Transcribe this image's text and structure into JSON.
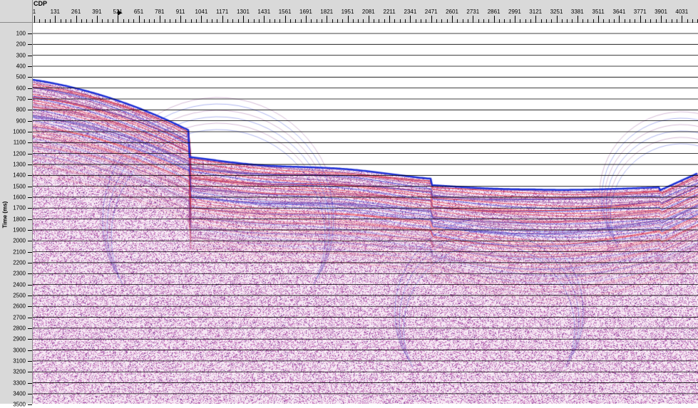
{
  "x_axis": {
    "title": "CDP",
    "ticks": [
      "1",
      "131",
      "261",
      "391",
      "521",
      "651",
      "781",
      "911",
      "1041",
      "1171",
      "1301",
      "1431",
      "1561",
      "1691",
      "1821",
      "1951",
      "2081",
      "2211",
      "2341",
      "2471",
      "2601",
      "2731",
      "2861",
      "2991",
      "3121",
      "3251",
      "3381",
      "3511",
      "3641",
      "3771",
      "3901",
      "4031"
    ]
  },
  "y_axis": {
    "title": "Time (ms)",
    "ticks": [
      "100",
      "200",
      "300",
      "400",
      "500",
      "600",
      "700",
      "800",
      "900",
      "1000",
      "1100",
      "1200",
      "1300",
      "1400",
      "1500",
      "1600",
      "1700",
      "1800",
      "1900",
      "2000",
      "2100",
      "2200",
      "2300",
      "2400",
      "2500",
      "2600",
      "2700",
      "2800",
      "2900",
      "3000",
      "3100",
      "3200",
      "3300",
      "3400",
      "3500"
    ]
  },
  "section": {
    "wiggle_colors": {
      "positive": "#1b2fd6",
      "negative": "#e8252a",
      "background": "#f6eef6",
      "noise": "#8a3d8f"
    }
  }
}
